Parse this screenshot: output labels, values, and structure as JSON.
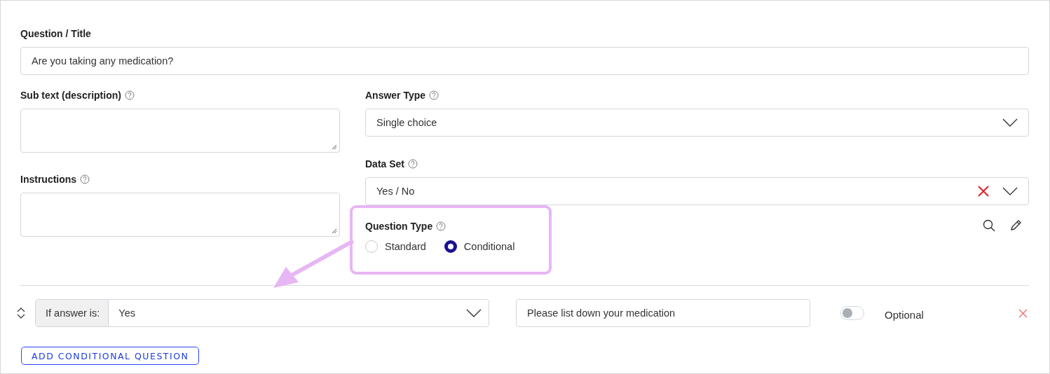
{
  "question_title": {
    "label": "Question / Title",
    "value": "Are you taking any medication?"
  },
  "sub_text": {
    "label": "Sub text (description)"
  },
  "instructions": {
    "label": "Instructions"
  },
  "answer_type": {
    "label": "Answer Type",
    "value": "Single choice"
  },
  "data_set": {
    "label": "Data Set",
    "value": "Yes / No"
  },
  "question_type": {
    "label": "Question Type",
    "options": [
      {
        "label": "Standard",
        "selected": false
      },
      {
        "label": "Conditional",
        "selected": true
      }
    ]
  },
  "conditions": [
    {
      "prefix": "If answer is:",
      "answer": "Yes",
      "question": "Please list down your medication",
      "optional": false,
      "optional_label": "Optional"
    }
  ],
  "add_button": "ADD CONDITIONAL QUESTION"
}
